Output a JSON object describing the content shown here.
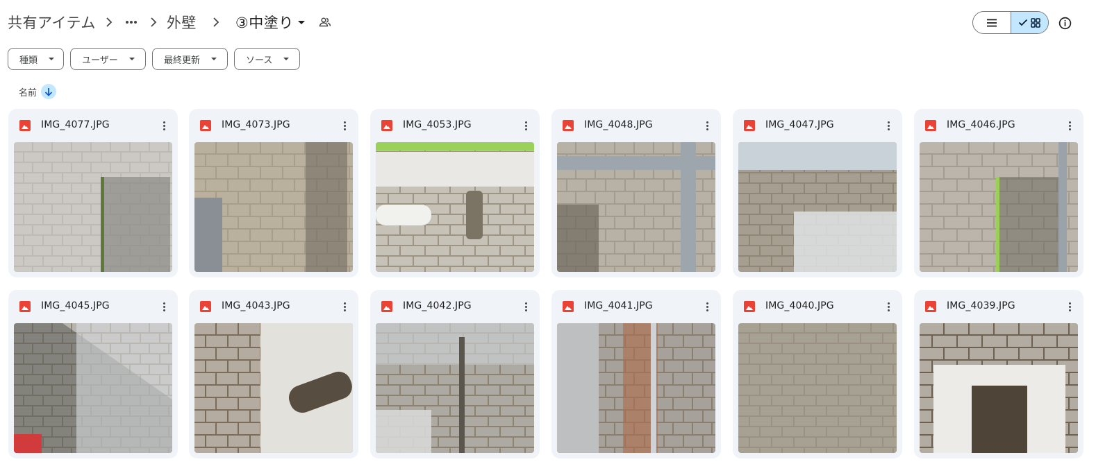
{
  "breadcrumb": {
    "root": "共有アイテム",
    "ellipsis": "…",
    "folder": "外壁",
    "current": "③中塗り",
    "shared_icon": "people-icon"
  },
  "view": {
    "mode": "grid",
    "list_icon": "list-icon",
    "grid_icon": "grid-icon",
    "check_icon": "check-icon"
  },
  "info_icon": "info-icon",
  "filters": [
    {
      "label": "種類"
    },
    {
      "label": "ユーザー"
    },
    {
      "label": "最終更新"
    },
    {
      "label": "ソース"
    }
  ],
  "sort": {
    "label": "名前",
    "direction_icon": "arrow-down-icon"
  },
  "colors": {
    "accent": "#c2e7ff",
    "card_bg": "#f0f4f9",
    "image_icon": "#ea4335"
  },
  "files": [
    {
      "name": "IMG_4077.JPG",
      "icon": "image-file-icon"
    },
    {
      "name": "IMG_4073.JPG",
      "icon": "image-file-icon"
    },
    {
      "name": "IMG_4053.JPG",
      "icon": "image-file-icon"
    },
    {
      "name": "IMG_4048.JPG",
      "icon": "image-file-icon"
    },
    {
      "name": "IMG_4047.JPG",
      "icon": "image-file-icon"
    },
    {
      "name": "IMG_4046.JPG",
      "icon": "image-file-icon"
    },
    {
      "name": "IMG_4045.JPG",
      "icon": "image-file-icon"
    },
    {
      "name": "IMG_4043.JPG",
      "icon": "image-file-icon"
    },
    {
      "name": "IMG_4042.JPG",
      "icon": "image-file-icon"
    },
    {
      "name": "IMG_4041.JPG",
      "icon": "image-file-icon"
    },
    {
      "name": "IMG_4040.JPG",
      "icon": "image-file-icon"
    },
    {
      "name": "IMG_4039.JPG",
      "icon": "image-file-icon"
    }
  ]
}
